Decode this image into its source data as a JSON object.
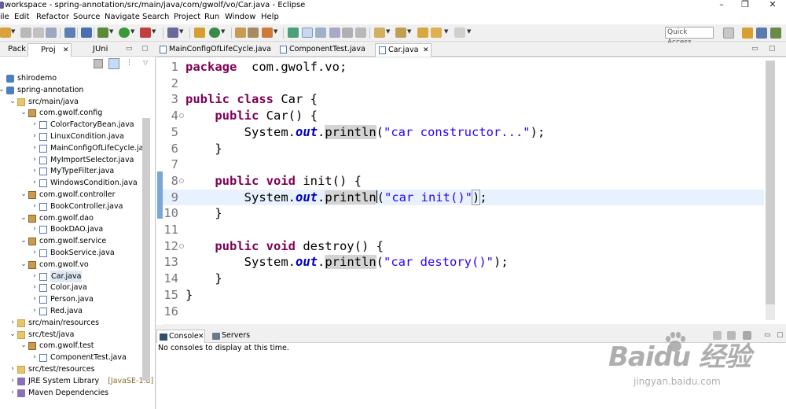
{
  "window": {
    "title": "workspace - spring-annotation/src/main/java/com/gwolf/vo/Car.java - Eclipse"
  },
  "menu": [
    "ile",
    "Edit",
    "Refactor",
    "Source",
    "Navigate",
    "Search",
    "Project",
    "Run",
    "Window",
    "Help"
  ],
  "toolbar": {
    "quick_access": "Quick Access"
  },
  "left_tabs": [
    "Pack",
    "Proj",
    "JUni"
  ],
  "tree": [
    {
      "label": "shirodemo",
      "indent": 0,
      "type": "project",
      "expanded": false,
      "arrow": false
    },
    {
      "label": "spring-annotation",
      "indent": 0,
      "type": "project",
      "expanded": true,
      "arrow": true
    },
    {
      "label": "src/main/java",
      "indent": 1,
      "type": "folder",
      "expanded": true,
      "arrow": true
    },
    {
      "label": "com.gwolf.config",
      "indent": 2,
      "type": "package",
      "expanded": true,
      "arrow": true
    },
    {
      "label": "ColorFactoryBean.java",
      "indent": 3,
      "type": "java",
      "expanded": false,
      "arrow": true
    },
    {
      "label": "LinuxCondition.java",
      "indent": 3,
      "type": "java",
      "expanded": false,
      "arrow": true
    },
    {
      "label": "MainConfigOfLifeCycle.jav",
      "indent": 3,
      "type": "java",
      "expanded": false,
      "arrow": true
    },
    {
      "label": "MyImportSelector.java",
      "indent": 3,
      "type": "java",
      "expanded": false,
      "arrow": true
    },
    {
      "label": "MyTypeFilter.java",
      "indent": 3,
      "type": "java",
      "expanded": false,
      "arrow": true
    },
    {
      "label": "WindowsCondition.java",
      "indent": 3,
      "type": "java",
      "expanded": false,
      "arrow": true
    },
    {
      "label": "com.gwolf.controller",
      "indent": 2,
      "type": "package",
      "expanded": true,
      "arrow": true
    },
    {
      "label": "BookController.java",
      "indent": 3,
      "type": "java",
      "expanded": false,
      "arrow": true
    },
    {
      "label": "com.gwolf.dao",
      "indent": 2,
      "type": "package",
      "expanded": true,
      "arrow": true
    },
    {
      "label": "BookDAO.java",
      "indent": 3,
      "type": "java",
      "expanded": false,
      "arrow": true
    },
    {
      "label": "com.gwolf.service",
      "indent": 2,
      "type": "package",
      "expanded": true,
      "arrow": true
    },
    {
      "label": "BookService.java",
      "indent": 3,
      "type": "java",
      "expanded": false,
      "arrow": true
    },
    {
      "label": "com.gwolf.vo",
      "indent": 2,
      "type": "package",
      "expanded": true,
      "arrow": true
    },
    {
      "label": "Car.java",
      "indent": 3,
      "type": "java",
      "expanded": false,
      "arrow": true,
      "selected": true
    },
    {
      "label": "Color.java",
      "indent": 3,
      "type": "java",
      "expanded": false,
      "arrow": true
    },
    {
      "label": "Person.java",
      "indent": 3,
      "type": "java",
      "expanded": false,
      "arrow": true
    },
    {
      "label": "Red.java",
      "indent": 3,
      "type": "java",
      "expanded": false,
      "arrow": true
    },
    {
      "label": "src/main/resources",
      "indent": 1,
      "type": "folder",
      "expanded": false,
      "arrow": true
    },
    {
      "label": "src/test/java",
      "indent": 1,
      "type": "folder",
      "expanded": true,
      "arrow": true
    },
    {
      "label": "com.gwolf.test",
      "indent": 2,
      "type": "package",
      "expanded": true,
      "arrow": true
    },
    {
      "label": "ComponentTest.java",
      "indent": 3,
      "type": "java",
      "expanded": false,
      "arrow": true
    },
    {
      "label": "src/test/resources",
      "indent": 1,
      "type": "folder",
      "expanded": false,
      "arrow": true
    },
    {
      "label": "JRE System Library",
      "decoration": "[JavaSE-1.8]",
      "indent": 1,
      "type": "lib",
      "expanded": false,
      "arrow": true
    },
    {
      "label": "Maven Dependencies",
      "indent": 1,
      "type": "lib",
      "expanded": false,
      "arrow": true
    }
  ],
  "editor": {
    "tabs": [
      {
        "label": "MainConfigOfLifeCycle.java",
        "active": false
      },
      {
        "label": "ComponentTest.java",
        "active": false
      },
      {
        "label": "Car.java",
        "active": true
      }
    ],
    "current_line": 9,
    "lines": [
      {
        "n": "1",
        "segs": [
          [
            "kw",
            "package"
          ],
          [
            "",
            "  com.gwolf.vo;"
          ]
        ]
      },
      {
        "n": "2",
        "segs": []
      },
      {
        "n": "3",
        "segs": [
          [
            "kw",
            "public class"
          ],
          [
            "",
            " Car {"
          ]
        ]
      },
      {
        "n": "4",
        "fold": true,
        "segs": [
          [
            "",
            "    "
          ],
          [
            "kw",
            "public"
          ],
          [
            "",
            " Car() {"
          ]
        ]
      },
      {
        "n": "5",
        "segs": [
          [
            "",
            "        System."
          ],
          [
            "fld",
            "out"
          ],
          [
            "",
            "."
          ],
          [
            "hl",
            "println"
          ],
          [
            "",
            "("
          ],
          [
            "str",
            "\"car constructor...\""
          ],
          [
            "",
            ");"
          ]
        ]
      },
      {
        "n": "6",
        "segs": [
          [
            "",
            "    }"
          ]
        ]
      },
      {
        "n": "7",
        "segs": []
      },
      {
        "n": "8",
        "fold": true,
        "segs": [
          [
            "",
            "    "
          ],
          [
            "kw",
            "public void"
          ],
          [
            "",
            " init() {"
          ]
        ]
      },
      {
        "n": "9",
        "segs": [
          [
            "",
            "        System."
          ],
          [
            "fld",
            "out"
          ],
          [
            "",
            "."
          ],
          [
            "hl",
            "println"
          ],
          [
            "caret",
            ""
          ],
          [
            "",
            "("
          ],
          [
            "str",
            "\"car init()\""
          ],
          [
            "brk",
            ")"
          ],
          [
            "",
            ";"
          ]
        ]
      },
      {
        "n": "10",
        "segs": [
          [
            "",
            "    }"
          ]
        ]
      },
      {
        "n": "11",
        "segs": []
      },
      {
        "n": "12",
        "fold": true,
        "segs": [
          [
            "",
            "    "
          ],
          [
            "kw",
            "public void"
          ],
          [
            "",
            " destroy() {"
          ]
        ]
      },
      {
        "n": "13",
        "segs": [
          [
            "",
            "        System."
          ],
          [
            "fld",
            "out"
          ],
          [
            "",
            "."
          ],
          [
            "hl",
            "println"
          ],
          [
            "",
            "("
          ],
          [
            "str",
            "\"car destory()\""
          ],
          [
            "",
            ");"
          ]
        ]
      },
      {
        "n": "14",
        "segs": [
          [
            "",
            "    }"
          ]
        ]
      },
      {
        "n": "15",
        "segs": [
          [
            "",
            "}"
          ]
        ]
      },
      {
        "n": "16",
        "segs": []
      }
    ]
  },
  "console": {
    "tabs": [
      "Console",
      "Servers"
    ],
    "message": "No consoles to display at this time."
  },
  "watermark": {
    "main": "Baidu 经验",
    "sub": "jingyan.baidu.com"
  }
}
